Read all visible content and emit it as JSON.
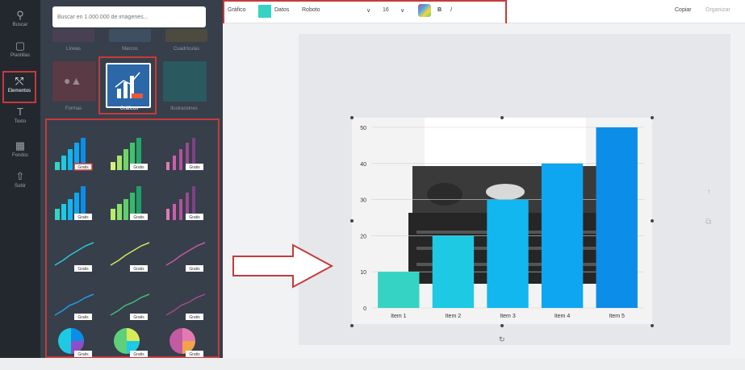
{
  "rail": [
    {
      "label": "Buscar",
      "icon": "search-icon"
    },
    {
      "label": "Plantillas",
      "icon": "template-icon"
    },
    {
      "label": "Elementos",
      "icon": "elements-icon",
      "active": true
    },
    {
      "label": "Texto",
      "icon": "text-icon"
    },
    {
      "label": "Fondos",
      "icon": "background-icon"
    },
    {
      "label": "Subir",
      "icon": "upload-icon"
    }
  ],
  "panel": {
    "search_placeholder": "Buscar en 1.000.000 de imágenes...",
    "row1_labels": [
      "Líneas",
      "Marcos",
      "Cuadrículas"
    ],
    "categories": [
      {
        "label": "Formas",
        "color": "#5a3a44"
      },
      {
        "label": "Gráficos",
        "color": "#2c67a8"
      },
      {
        "label": "Ilustraciones",
        "color": "#2a5a5f"
      }
    ],
    "tile_badge": "Gratis"
  },
  "toolbar": {
    "left_label": "Gráfico",
    "color_label": "Datos",
    "font": "Roboto",
    "font_size": "16",
    "bold": "B",
    "italic": "I",
    "right1": "Copiar",
    "right2": "Organizar"
  },
  "colors": {
    "accent": "#c63a3a",
    "teal": "#34d3c4",
    "sky": "#1eb7ef"
  },
  "chart_data": {
    "type": "bar",
    "categories": [
      "Item 1",
      "Item 2",
      "Item 3",
      "Item 4",
      "Item 5"
    ],
    "values": [
      10,
      20,
      30,
      40,
      50
    ],
    "ylim": [
      0,
      50
    ],
    "yticks": [
      0,
      10,
      20,
      30,
      40,
      50
    ],
    "colors": [
      "#34d3c4",
      "#1ec9e3",
      "#12b7ef",
      "#0ea6f0",
      "#0c8de8"
    ],
    "grid": true
  }
}
